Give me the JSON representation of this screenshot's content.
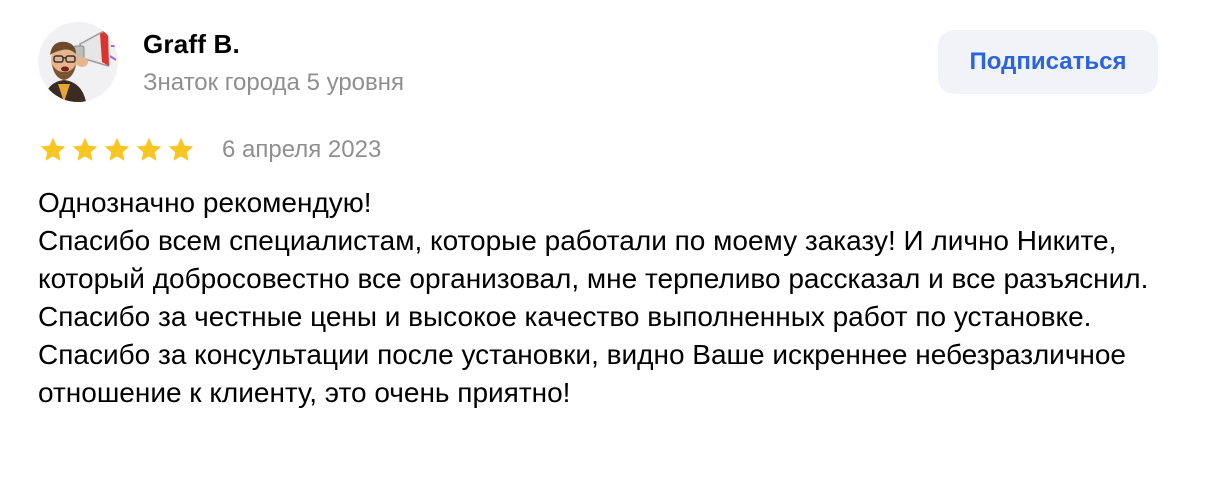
{
  "author": {
    "name": "Graff B.",
    "level": "Знаток города 5 уровня",
    "avatar_icon": "avatar-megaphone-man"
  },
  "subscribe_button": {
    "label": "Подписаться"
  },
  "review": {
    "rating": 5,
    "rating_max": 5,
    "date": "6 апреля 2023",
    "paragraphs": [
      "Однозначно рекомендую!",
      "Спасибо всем специалистам, которые работали по моему заказу! И лично Никите, который добросовестно все организовал, мне терпеливо рассказал и все разъяснил. Спасибо за честные цены и высокое качество выполненных работ по установке. Спасибо за консультации после установки, видно Ваше искреннее небезразличное отношение к клиенту, это очень приятно!"
    ]
  },
  "colors": {
    "star": "#f7c623",
    "link_blue": "#2b65de",
    "button_bg": "#f1f3f9",
    "muted_text": "#8f8f8f"
  }
}
